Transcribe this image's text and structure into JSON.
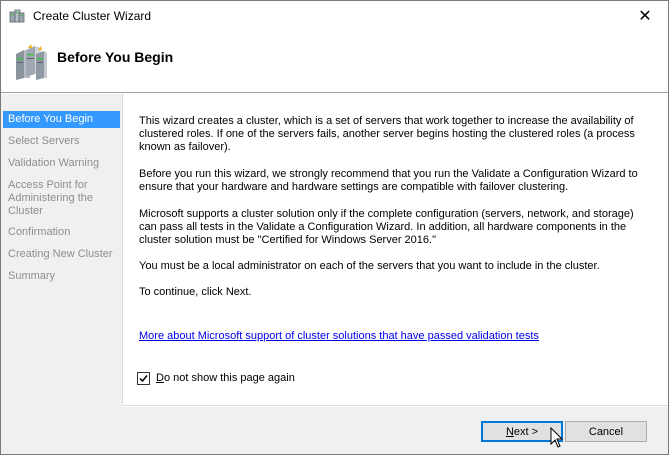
{
  "window": {
    "title": "Create Cluster Wizard",
    "close_glyph": "✕"
  },
  "header": {
    "title": "Before You Begin",
    "icon": "cluster-servers-icon"
  },
  "nav": {
    "items": [
      {
        "label": "Before You Begin",
        "active": true
      },
      {
        "label": "Select Servers",
        "active": false
      },
      {
        "label": "Validation Warning",
        "active": false
      },
      {
        "label": "Access Point for Administering the Cluster",
        "active": false
      },
      {
        "label": "Confirmation",
        "active": false
      },
      {
        "label": "Creating New Cluster",
        "active": false
      },
      {
        "label": "Summary",
        "active": false
      }
    ]
  },
  "content": {
    "paragraphs": [
      "This wizard creates a cluster, which is a set of servers that work together to increase the availability of clustered roles. If one of the servers fails, another server begins hosting the clustered roles (a process known as failover).",
      "Before you run this wizard, we strongly recommend that you run the Validate a Configuration Wizard to ensure that your hardware and hardware settings are compatible with failover clustering.",
      "Microsoft supports a cluster solution only if the complete configuration (servers, network, and storage) can pass all tests in the Validate a Configuration Wizard. In addition, all hardware components in the cluster solution must be \"Certified for Windows Server 2016.\"",
      "You must be a local administrator on each of the servers that you want to include in the cluster.",
      "To continue, click Next."
    ],
    "link": "More about Microsoft support of cluster solutions that have passed validation tests",
    "checkbox": {
      "label_prefix": "D",
      "label_rest": "o not show this page again",
      "checked": true
    }
  },
  "footer": {
    "next_label_ul": "N",
    "next_label_rest": "ext >",
    "cancel_label": "Cancel"
  },
  "colors": {
    "accent": "#3399ff",
    "link": "#0000ee",
    "nav_bg": "#f0f0f0",
    "disabled_text": "#8e8e8e",
    "button_focus": "#0078d7"
  }
}
